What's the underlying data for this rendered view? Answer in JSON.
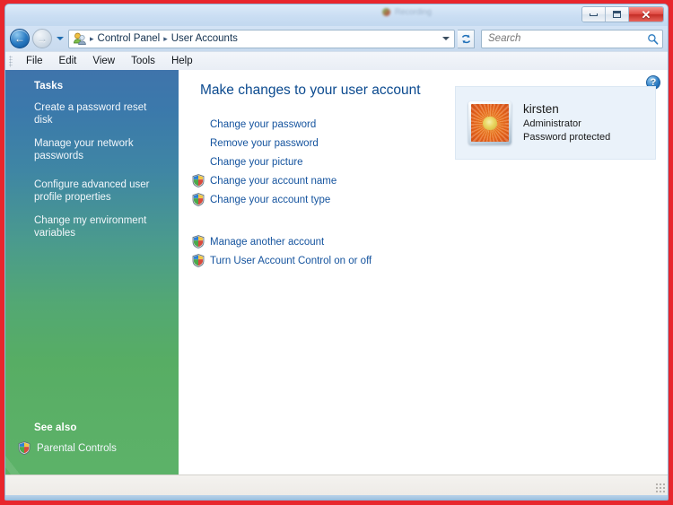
{
  "window": {
    "controls": {
      "minimize": "Minimize",
      "maximize": "Maximize",
      "close": "Close"
    },
    "ghost_text": "Recording"
  },
  "navbar": {
    "back_label": "Back",
    "forward_label": "Forward",
    "history_label": "Recent pages",
    "breadcrumb": [
      "Control Panel",
      "User Accounts"
    ],
    "separator": "▸",
    "address_dropdown_label": "Previous locations",
    "refresh_label": "Refresh",
    "search_placeholder": "Search",
    "search_value": ""
  },
  "menubar": {
    "items": [
      "File",
      "Edit",
      "View",
      "Tools",
      "Help"
    ]
  },
  "sidebar": {
    "heading": "Tasks",
    "tasks": [
      "Create a password reset disk",
      "Manage your network passwords",
      "Configure advanced user profile properties",
      "Change my environment variables"
    ],
    "see_also_heading": "See also",
    "see_also": [
      {
        "label": "Parental Controls",
        "icon": "shield-icon"
      }
    ]
  },
  "main": {
    "help_label": "?",
    "title": "Make changes to your user account",
    "primary_links": [
      {
        "label": "Change your password",
        "icon": null
      },
      {
        "label": "Remove your password",
        "icon": null
      },
      {
        "label": "Change your picture",
        "icon": null
      },
      {
        "label": "Change your account name",
        "icon": "shield-icon"
      },
      {
        "label": "Change your account type",
        "icon": "shield-icon"
      }
    ],
    "secondary_links": [
      {
        "label": "Manage another account",
        "icon": "shield-icon"
      },
      {
        "label": "Turn User Account Control on or off",
        "icon": "shield-icon"
      }
    ],
    "account": {
      "picture": "orange-flower-avatar",
      "name": "kirsten",
      "account_type": "Administrator",
      "password_status": "Password protected"
    }
  },
  "statusbar": {
    "text": ""
  },
  "colors": {
    "accent_link": "#14539e",
    "heading": "#0b4a8f",
    "sidebar_top": "#3f74ab",
    "sidebar_bottom": "#5cb268",
    "card_bg": "#eaf2fa",
    "capture_border": "#e8262c"
  }
}
